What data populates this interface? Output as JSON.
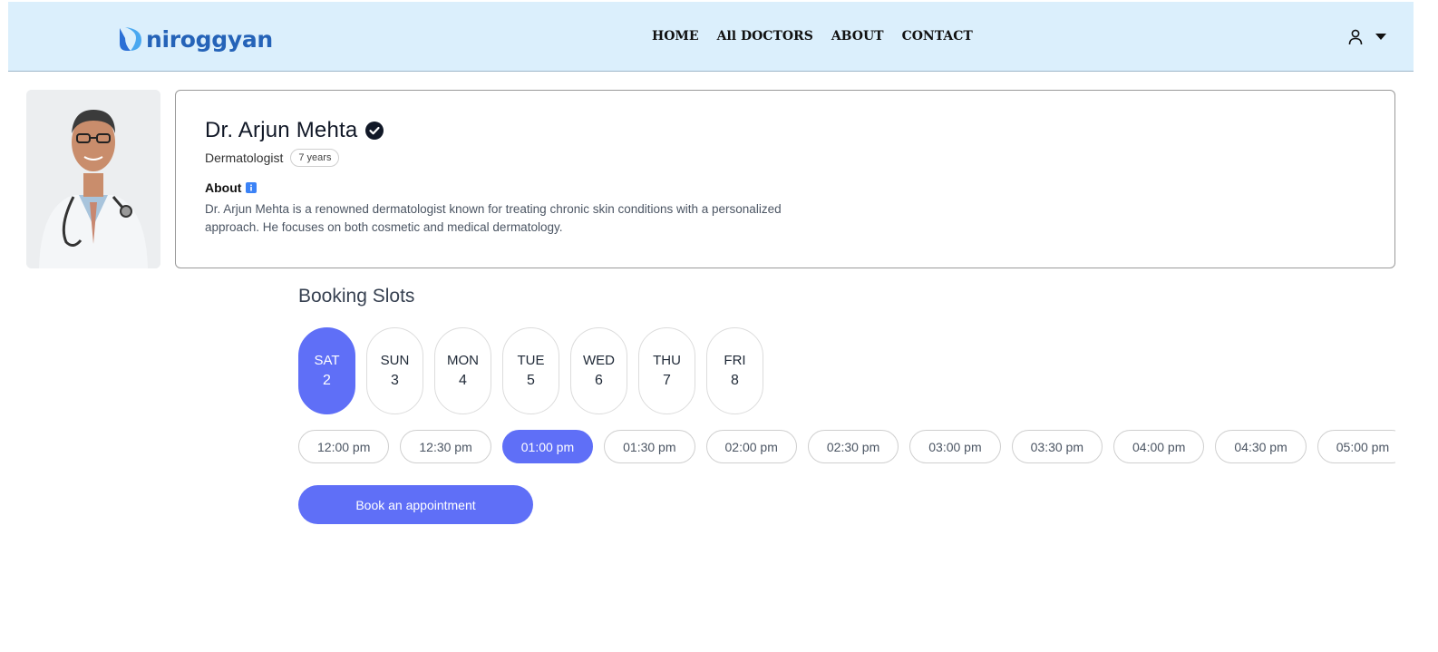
{
  "brand": {
    "name": "niroggyan",
    "color": "#2563b8"
  },
  "nav": {
    "links": [
      "HOME",
      "All DOCTORS",
      "ABOUT",
      "CONTACT"
    ],
    "user_icon": "user-icon",
    "menu_icon": "caret-down-icon"
  },
  "doctor": {
    "name": "Dr. Arjun Mehta",
    "verified_icon": "verified-icon",
    "speciality": "Dermatologist",
    "experience": "7 years",
    "about_title": "About",
    "about_icon": "info-icon",
    "about_text": "Dr. Arjun Mehta is a renowned dermatologist known for treating chronic skin conditions with a personalized approach. He focuses on both cosmetic and medical dermatology."
  },
  "booking": {
    "title": "Booking Slots",
    "days": [
      {
        "day": "SAT",
        "date": "2",
        "selected": true
      },
      {
        "day": "SUN",
        "date": "3",
        "selected": false
      },
      {
        "day": "MON",
        "date": "4",
        "selected": false
      },
      {
        "day": "TUE",
        "date": "5",
        "selected": false
      },
      {
        "day": "WED",
        "date": "6",
        "selected": false
      },
      {
        "day": "THU",
        "date": "7",
        "selected": false
      },
      {
        "day": "FRI",
        "date": "8",
        "selected": false
      }
    ],
    "times": [
      {
        "label": "12:00 pm",
        "selected": false
      },
      {
        "label": "12:30 pm",
        "selected": false
      },
      {
        "label": "01:00 pm",
        "selected": true
      },
      {
        "label": "01:30 pm",
        "selected": false
      },
      {
        "label": "02:00 pm",
        "selected": false
      },
      {
        "label": "02:30 pm",
        "selected": false
      },
      {
        "label": "03:00 pm",
        "selected": false
      },
      {
        "label": "03:30 pm",
        "selected": false
      },
      {
        "label": "04:00 pm",
        "selected": false
      },
      {
        "label": "04:30 pm",
        "selected": false
      },
      {
        "label": "05:00 pm",
        "selected": false
      }
    ],
    "book_label": "Book an appointment",
    "accent": "#5f6ff7"
  }
}
